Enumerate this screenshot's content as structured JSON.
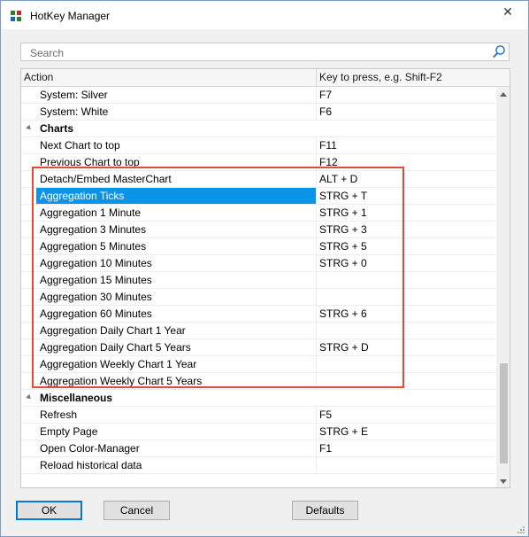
{
  "window": {
    "title": "HotKey Manager",
    "close_glyph": "✕"
  },
  "search": {
    "placeholder": "Search",
    "value": ""
  },
  "table": {
    "col_action": "Action",
    "col_key": "Key to press, e.g. Shift-F2",
    "rows": [
      {
        "type": "item",
        "action": "System: Silver",
        "key": "F7"
      },
      {
        "type": "item",
        "action": "System: White",
        "key": "F6"
      },
      {
        "type": "group",
        "action": "Charts",
        "key": ""
      },
      {
        "type": "item",
        "action": "Next Chart to top",
        "key": "F11"
      },
      {
        "type": "item",
        "action": "Previous Chart to top",
        "key": "F12"
      },
      {
        "type": "item",
        "action": "Detach/Embed MasterChart",
        "key": "ALT + D"
      },
      {
        "type": "item",
        "action": "Aggregation Ticks",
        "key": "STRG + T",
        "selected": true
      },
      {
        "type": "item",
        "action": "Aggregation 1 Minute",
        "key": "STRG + 1"
      },
      {
        "type": "item",
        "action": "Aggregation 3 Minutes",
        "key": "STRG + 3"
      },
      {
        "type": "item",
        "action": "Aggregation 5 Minutes",
        "key": "STRG + 5"
      },
      {
        "type": "item",
        "action": "Aggregation 10 Minutes",
        "key": "STRG + 0"
      },
      {
        "type": "item",
        "action": "Aggregation 15 Minutes",
        "key": ""
      },
      {
        "type": "item",
        "action": "Aggregation 30 Minutes",
        "key": ""
      },
      {
        "type": "item",
        "action": "Aggregation 60 Minutes",
        "key": "STRG + 6"
      },
      {
        "type": "item",
        "action": "Aggregation Daily Chart 1 Year",
        "key": ""
      },
      {
        "type": "item",
        "action": "Aggregation Daily Chart 5 Years",
        "key": "STRG + D"
      },
      {
        "type": "item",
        "action": "Aggregation Weekly Chart 1 Year",
        "key": ""
      },
      {
        "type": "item",
        "action": "Aggregation Weekly Chart 5 Years",
        "key": ""
      },
      {
        "type": "group",
        "action": "Miscellaneous",
        "key": ""
      },
      {
        "type": "item",
        "action": "Refresh",
        "key": "F5"
      },
      {
        "type": "item",
        "action": "Empty Page",
        "key": "STRG + E"
      },
      {
        "type": "item",
        "action": "Open Color-Manager",
        "key": "F1"
      },
      {
        "type": "item",
        "action": "Reload historical data",
        "key": ""
      }
    ]
  },
  "buttons": {
    "ok": "OK",
    "cancel": "Cancel",
    "defaults": "Defaults"
  },
  "colors": {
    "selection": "#0a93e8",
    "highlight_frame": "#e64a34",
    "default_button_border": "#0078d7"
  }
}
